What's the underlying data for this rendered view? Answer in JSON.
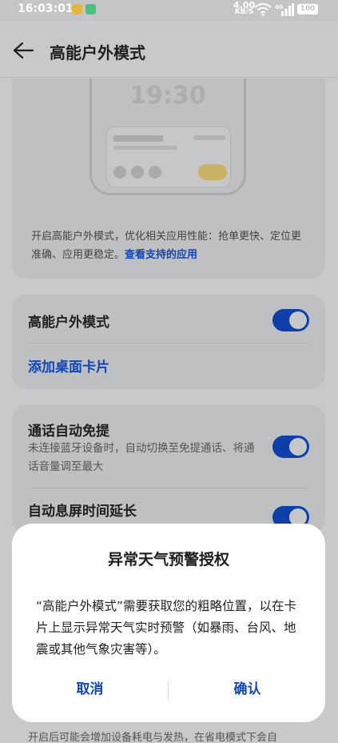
{
  "status_bar": {
    "time": "16:03:01",
    "speed_value": "4.00",
    "speed_unit": "KB/S",
    "network": "4G",
    "battery": "100"
  },
  "header": {
    "title": "高能户外模式"
  },
  "preview": {
    "clock": "19:30",
    "description": "开启高能户外模式，优化相关应用性能：抢单更快、定位更准确、应用更稳定。",
    "link": "查看支持的应用"
  },
  "main_setting": {
    "label": "高能户外模式",
    "enabled": true,
    "add_card": "添加桌面卡片"
  },
  "settings": [
    {
      "label": "通话自动免提",
      "description": "未连接蓝牙设备时，自动切换至免提通话、将通话音量调至最大",
      "enabled": true
    },
    {
      "label": "自动息屏时间延长",
      "enabled": true
    }
  ],
  "footer_note": "开启后可能会增加设备耗电与发热，在省电模式下会自",
  "dialog": {
    "title": "异常天气预警授权",
    "body": "“高能户外模式”需要获取您的粗略位置，以在卡片上显示异常天气实时预警（如暴雨、台风、地震或其他气象灾害等）。",
    "cancel": "取消",
    "confirm": "确认"
  },
  "colors": {
    "accent": "#0f46b8",
    "toggle_on": "#0f3fa9",
    "dim_background": "#c8c9ca",
    "card_background": "#bfc0c1",
    "dialog_background": "#ffffff"
  }
}
